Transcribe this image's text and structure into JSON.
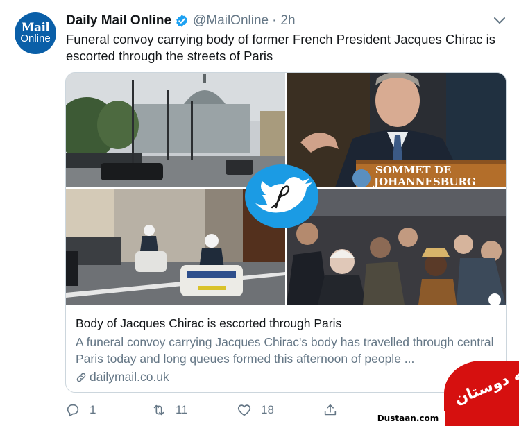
{
  "author": {
    "avatar_line1": "Mail",
    "avatar_line2": "Online",
    "name": "Daily Mail Online",
    "handle": "@MailOnline",
    "separator": "·",
    "time": "2h"
  },
  "tweet": {
    "text": "Funeral convoy carrying body of former French President Jacques Chirac is escorted through the streets of Paris"
  },
  "card": {
    "podium_sign": "SOMMET DE JOHANNESBURG",
    "title": "Body of Jacques Chirac is escorted through Paris",
    "description": "A funeral convoy carrying Jacques Chirac's body has travelled through central Paris today and long queues formed this afternoon of people ...",
    "domain": "dailymail.co.uk"
  },
  "actions": {
    "reply_count": "1",
    "retweet_count": "11",
    "like_count": "18"
  },
  "watermark": {
    "text": "مجله دوستان",
    "url": "Dustaan.com"
  },
  "colors": {
    "verified": "#1da1f2",
    "secondary_text": "#657786",
    "border": "#ccd6dd",
    "avatar_bg": "#0a5fa8",
    "watermark_red": "#d6100f"
  }
}
